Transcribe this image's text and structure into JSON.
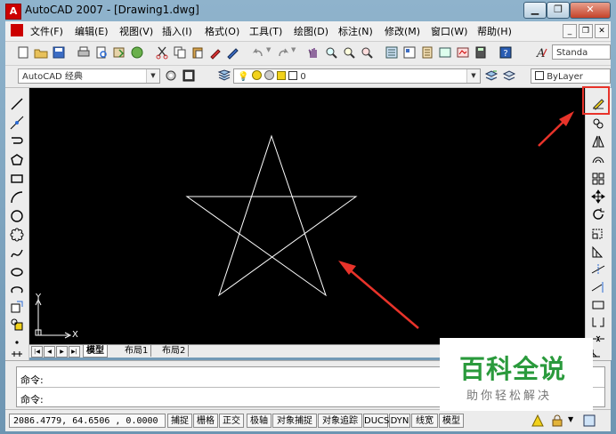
{
  "window": {
    "title": "AutoCAD 2007 - [Drawing1.dwg]",
    "app_icon": "A"
  },
  "menu": {
    "items": [
      "文件(F)",
      "编辑(E)",
      "视图(V)",
      "插入(I)",
      "格式(O)",
      "工具(T)",
      "绘图(D)",
      "标注(N)",
      "修改(M)",
      "窗口(W)",
      "帮助(H)"
    ]
  },
  "toolbar": {
    "style_combo": "Standa"
  },
  "workspace": {
    "combo_value": "AutoCAD 经典"
  },
  "layer": {
    "combo_value": "0"
  },
  "bylayer": {
    "combo_value": "ByLayer"
  },
  "layout_tabs": [
    "模型",
    "布局1",
    "布局2"
  ],
  "command": {
    "lines": [
      "命令:",
      "命令:"
    ]
  },
  "status": {
    "coords": "2086.4779, 64.6506  , 0.0000",
    "buttons": [
      "捕捉",
      "栅格",
      "正交",
      "极轴",
      "对象捕捉",
      "对象追踪",
      "DUCS",
      "DYN",
      "线宽",
      "模型"
    ]
  },
  "ucs": {
    "x_label": "X",
    "y_label": "Y"
  },
  "watermark": {
    "main": "百科全说",
    "sub": "助你轻松解决"
  },
  "colors": {
    "canvas": "#000000",
    "annotation": "#e8332a",
    "watermark": "#2a9a3c"
  }
}
